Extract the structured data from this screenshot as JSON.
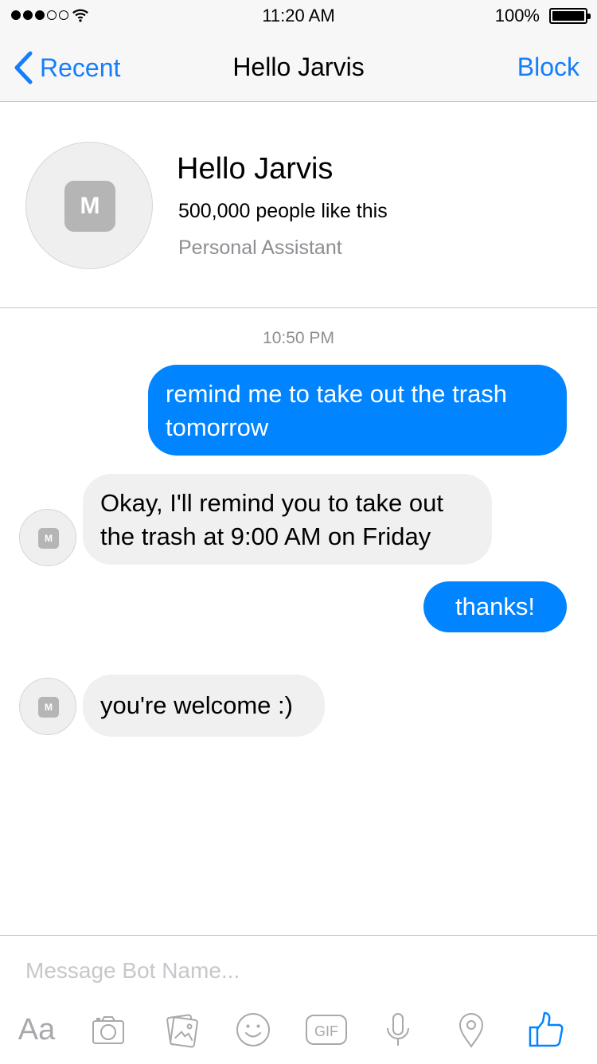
{
  "status_bar": {
    "time": "11:20 AM",
    "battery_percent": "100%",
    "signal_bars_filled": 3,
    "signal_bars_total": 5
  },
  "nav": {
    "back_label": "Recent",
    "title": "Hello Jarvis",
    "block_label": "Block"
  },
  "profile": {
    "avatar_letter": "M",
    "name": "Hello Jarvis",
    "likes": "500,000 people like this",
    "category": "Personal Assistant"
  },
  "conversation": {
    "timestamp": "10:50 PM",
    "bot_avatar_letter": "M",
    "messages": [
      {
        "sender": "user",
        "text": "remind me to take out the trash tomorrow"
      },
      {
        "sender": "bot",
        "text": "Okay, I'll remind you to take out the trash at 9:00 AM on Friday"
      },
      {
        "sender": "user",
        "text": "thanks!"
      },
      {
        "sender": "bot",
        "text": "you're welcome :)"
      }
    ]
  },
  "composer": {
    "placeholder": "Message Bot Name...",
    "text_tool_label": "Aa",
    "gif_label": "GIF",
    "tools": [
      "text-icon",
      "camera-icon",
      "photos-icon",
      "emoji-icon",
      "gif-icon",
      "microphone-icon",
      "location-icon",
      "like-icon"
    ]
  },
  "colors": {
    "accent": "#147efb",
    "outgoing_bubble": "#0084ff",
    "incoming_bubble": "#f1f0f0",
    "toolbar_icon": "#a8a8ad",
    "like_icon": "#0084ff"
  }
}
